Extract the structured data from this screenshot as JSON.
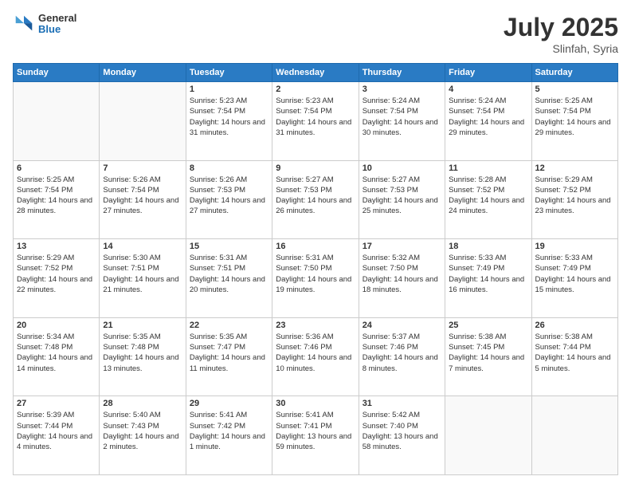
{
  "header": {
    "logo": {
      "general": "General",
      "blue": "Blue"
    },
    "title": "July 2025",
    "location": "Slinfah, Syria"
  },
  "days_of_week": [
    "Sunday",
    "Monday",
    "Tuesday",
    "Wednesday",
    "Thursday",
    "Friday",
    "Saturday"
  ],
  "weeks": [
    [
      {
        "day": "",
        "sunrise": "",
        "sunset": "",
        "daylight": ""
      },
      {
        "day": "",
        "sunrise": "",
        "sunset": "",
        "daylight": ""
      },
      {
        "day": "1",
        "sunrise": "Sunrise: 5:23 AM",
        "sunset": "Sunset: 7:54 PM",
        "daylight": "Daylight: 14 hours and 31 minutes."
      },
      {
        "day": "2",
        "sunrise": "Sunrise: 5:23 AM",
        "sunset": "Sunset: 7:54 PM",
        "daylight": "Daylight: 14 hours and 31 minutes."
      },
      {
        "day": "3",
        "sunrise": "Sunrise: 5:24 AM",
        "sunset": "Sunset: 7:54 PM",
        "daylight": "Daylight: 14 hours and 30 minutes."
      },
      {
        "day": "4",
        "sunrise": "Sunrise: 5:24 AM",
        "sunset": "Sunset: 7:54 PM",
        "daylight": "Daylight: 14 hours and 29 minutes."
      },
      {
        "day": "5",
        "sunrise": "Sunrise: 5:25 AM",
        "sunset": "Sunset: 7:54 PM",
        "daylight": "Daylight: 14 hours and 29 minutes."
      }
    ],
    [
      {
        "day": "6",
        "sunrise": "Sunrise: 5:25 AM",
        "sunset": "Sunset: 7:54 PM",
        "daylight": "Daylight: 14 hours and 28 minutes."
      },
      {
        "day": "7",
        "sunrise": "Sunrise: 5:26 AM",
        "sunset": "Sunset: 7:54 PM",
        "daylight": "Daylight: 14 hours and 27 minutes."
      },
      {
        "day": "8",
        "sunrise": "Sunrise: 5:26 AM",
        "sunset": "Sunset: 7:53 PM",
        "daylight": "Daylight: 14 hours and 27 minutes."
      },
      {
        "day": "9",
        "sunrise": "Sunrise: 5:27 AM",
        "sunset": "Sunset: 7:53 PM",
        "daylight": "Daylight: 14 hours and 26 minutes."
      },
      {
        "day": "10",
        "sunrise": "Sunrise: 5:27 AM",
        "sunset": "Sunset: 7:53 PM",
        "daylight": "Daylight: 14 hours and 25 minutes."
      },
      {
        "day": "11",
        "sunrise": "Sunrise: 5:28 AM",
        "sunset": "Sunset: 7:52 PM",
        "daylight": "Daylight: 14 hours and 24 minutes."
      },
      {
        "day": "12",
        "sunrise": "Sunrise: 5:29 AM",
        "sunset": "Sunset: 7:52 PM",
        "daylight": "Daylight: 14 hours and 23 minutes."
      }
    ],
    [
      {
        "day": "13",
        "sunrise": "Sunrise: 5:29 AM",
        "sunset": "Sunset: 7:52 PM",
        "daylight": "Daylight: 14 hours and 22 minutes."
      },
      {
        "day": "14",
        "sunrise": "Sunrise: 5:30 AM",
        "sunset": "Sunset: 7:51 PM",
        "daylight": "Daylight: 14 hours and 21 minutes."
      },
      {
        "day": "15",
        "sunrise": "Sunrise: 5:31 AM",
        "sunset": "Sunset: 7:51 PM",
        "daylight": "Daylight: 14 hours and 20 minutes."
      },
      {
        "day": "16",
        "sunrise": "Sunrise: 5:31 AM",
        "sunset": "Sunset: 7:50 PM",
        "daylight": "Daylight: 14 hours and 19 minutes."
      },
      {
        "day": "17",
        "sunrise": "Sunrise: 5:32 AM",
        "sunset": "Sunset: 7:50 PM",
        "daylight": "Daylight: 14 hours and 18 minutes."
      },
      {
        "day": "18",
        "sunrise": "Sunrise: 5:33 AM",
        "sunset": "Sunset: 7:49 PM",
        "daylight": "Daylight: 14 hours and 16 minutes."
      },
      {
        "day": "19",
        "sunrise": "Sunrise: 5:33 AM",
        "sunset": "Sunset: 7:49 PM",
        "daylight": "Daylight: 14 hours and 15 minutes."
      }
    ],
    [
      {
        "day": "20",
        "sunrise": "Sunrise: 5:34 AM",
        "sunset": "Sunset: 7:48 PM",
        "daylight": "Daylight: 14 hours and 14 minutes."
      },
      {
        "day": "21",
        "sunrise": "Sunrise: 5:35 AM",
        "sunset": "Sunset: 7:48 PM",
        "daylight": "Daylight: 14 hours and 13 minutes."
      },
      {
        "day": "22",
        "sunrise": "Sunrise: 5:35 AM",
        "sunset": "Sunset: 7:47 PM",
        "daylight": "Daylight: 14 hours and 11 minutes."
      },
      {
        "day": "23",
        "sunrise": "Sunrise: 5:36 AM",
        "sunset": "Sunset: 7:46 PM",
        "daylight": "Daylight: 14 hours and 10 minutes."
      },
      {
        "day": "24",
        "sunrise": "Sunrise: 5:37 AM",
        "sunset": "Sunset: 7:46 PM",
        "daylight": "Daylight: 14 hours and 8 minutes."
      },
      {
        "day": "25",
        "sunrise": "Sunrise: 5:38 AM",
        "sunset": "Sunset: 7:45 PM",
        "daylight": "Daylight: 14 hours and 7 minutes."
      },
      {
        "day": "26",
        "sunrise": "Sunrise: 5:38 AM",
        "sunset": "Sunset: 7:44 PM",
        "daylight": "Daylight: 14 hours and 5 minutes."
      }
    ],
    [
      {
        "day": "27",
        "sunrise": "Sunrise: 5:39 AM",
        "sunset": "Sunset: 7:44 PM",
        "daylight": "Daylight: 14 hours and 4 minutes."
      },
      {
        "day": "28",
        "sunrise": "Sunrise: 5:40 AM",
        "sunset": "Sunset: 7:43 PM",
        "daylight": "Daylight: 14 hours and 2 minutes."
      },
      {
        "day": "29",
        "sunrise": "Sunrise: 5:41 AM",
        "sunset": "Sunset: 7:42 PM",
        "daylight": "Daylight: 14 hours and 1 minute."
      },
      {
        "day": "30",
        "sunrise": "Sunrise: 5:41 AM",
        "sunset": "Sunset: 7:41 PM",
        "daylight": "Daylight: 13 hours and 59 minutes."
      },
      {
        "day": "31",
        "sunrise": "Sunrise: 5:42 AM",
        "sunset": "Sunset: 7:40 PM",
        "daylight": "Daylight: 13 hours and 58 minutes."
      },
      {
        "day": "",
        "sunrise": "",
        "sunset": "",
        "daylight": ""
      },
      {
        "day": "",
        "sunrise": "",
        "sunset": "",
        "daylight": ""
      }
    ]
  ]
}
